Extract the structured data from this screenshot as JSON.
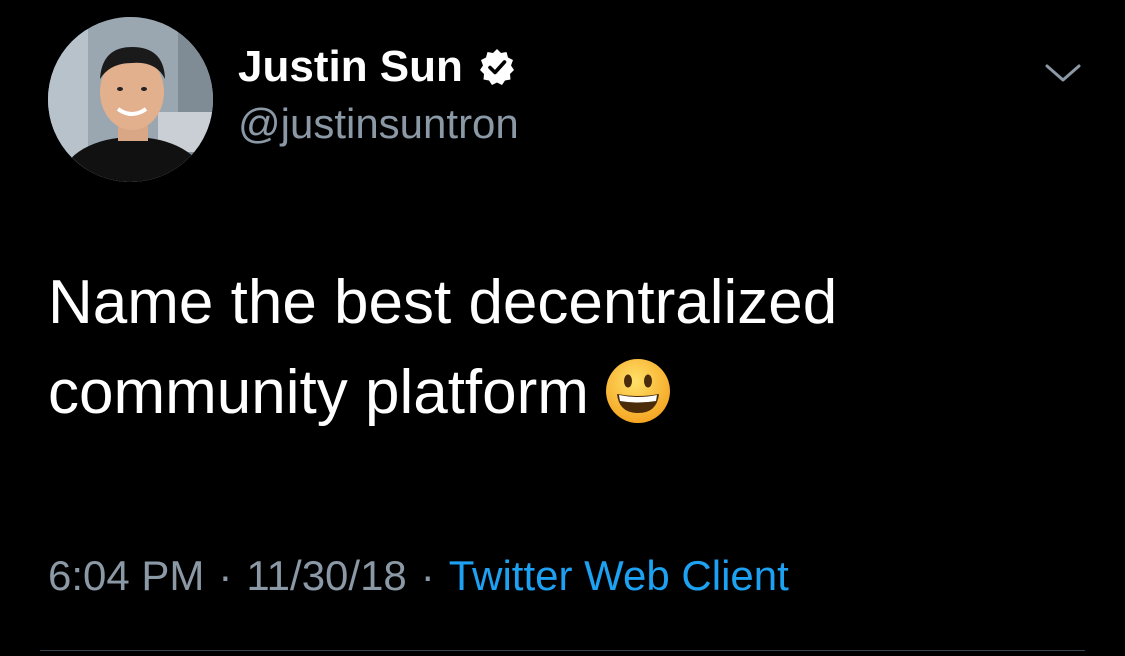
{
  "author": {
    "display_name": "Justin Sun",
    "handle": "@justinsuntron",
    "verified": true
  },
  "tweet": {
    "text_lines": [
      "Name the best decentralized",
      "community platform"
    ],
    "emoji": "grinning-face"
  },
  "meta": {
    "time": "6:04 PM",
    "separator": "·",
    "date": "11/30/18",
    "client": "Twitter Web Client"
  },
  "icons": {
    "verified": "verified-badge-icon",
    "menu": "chevron-down-icon"
  },
  "colors": {
    "background": "#000000",
    "primary_text": "#ffffff",
    "secondary_text": "#8b98a5",
    "link": "#1da1f2",
    "divider": "#38444d"
  }
}
